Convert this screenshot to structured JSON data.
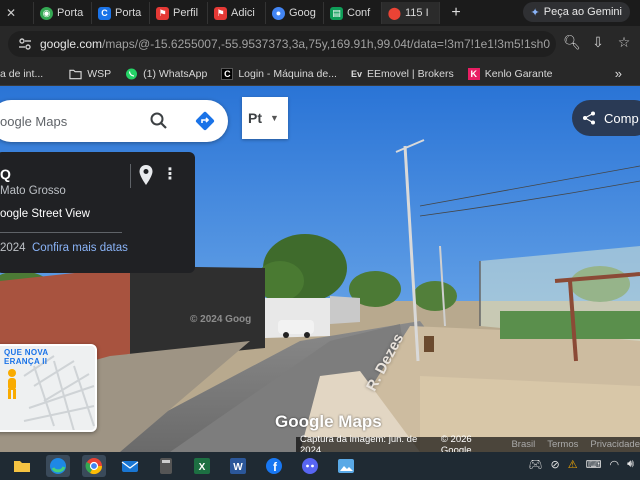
{
  "browser": {
    "tabs": [
      {
        "label": "Porta",
        "favicon": "globe-icon",
        "color": "#34a853"
      },
      {
        "label": "Porta",
        "favicon": "c-icon",
        "color": "#1a73e8"
      },
      {
        "label": "Perfil",
        "favicon": "bookmark-red-icon",
        "color": "#e53935"
      },
      {
        "label": "Adici",
        "favicon": "bookmark-red-icon",
        "color": "#e53935"
      },
      {
        "label": "Goog",
        "favicon": "google-icon",
        "color": "#4285f4"
      },
      {
        "label": "Conf",
        "favicon": "sheets-icon",
        "color": "#0f9d58"
      },
      {
        "label": "115 I",
        "favicon": "maps-pin-icon",
        "color": "#ea4335"
      }
    ],
    "new_tab": "+",
    "gemini_label": "Peça ao Gemini",
    "url_host": "google.com",
    "url_path": "/maps/@-15.6255007,-55.9537373,3a,75y,169.91h,99.04t/data=!3m7!1e1!3m5!1sh0W6jnK..."
  },
  "bookmarks": [
    {
      "label": "a de int...",
      "icon": "text-icon"
    },
    {
      "label": "WSP",
      "icon": "folder-icon"
    },
    {
      "label": "(1) WhatsApp",
      "icon": "whatsapp-icon"
    },
    {
      "label": "Login - Máquina de...",
      "icon": "c-icon"
    },
    {
      "label": "EEmovel | Brokers",
      "icon": "ev-icon"
    },
    {
      "label": "Kenlo Garante",
      "icon": "k-icon"
    }
  ],
  "maps": {
    "search_placeholder": "oogle Maps",
    "language_code": "Pt",
    "share_label": "Comp",
    "card": {
      "title": "Q",
      "subtitle": "Mato Grosso",
      "street_view_label": "oogle Street View",
      "year": "2024",
      "more_dates_link": "Confira mais datas"
    },
    "minimap_label_1": "QUE NOVA",
    "minimap_label_2": "ERANÇA II",
    "watermark": "Google Maps",
    "watermark_small": "© 2024 Goog",
    "street_name": "R. Dezes",
    "attribution": {
      "capture": "Captura da imagem: jun. de 2024",
      "copyright": "© 2026 Google",
      "country": "Brasil",
      "terms": "Termos",
      "privacy": "Privacidade"
    }
  },
  "taskbar": {
    "apps": [
      "file-explorer-icon",
      "edge-icon",
      "chrome-icon",
      "mail-icon",
      "calculator-icon",
      "excel-icon",
      "word-icon",
      "facebook-icon",
      "discord-icon",
      "photos-icon"
    ],
    "tray": [
      "discord-tray-icon",
      "network-off-icon",
      "warning-icon",
      "lang-icon",
      "wifi-icon",
      "volume-icon"
    ]
  }
}
